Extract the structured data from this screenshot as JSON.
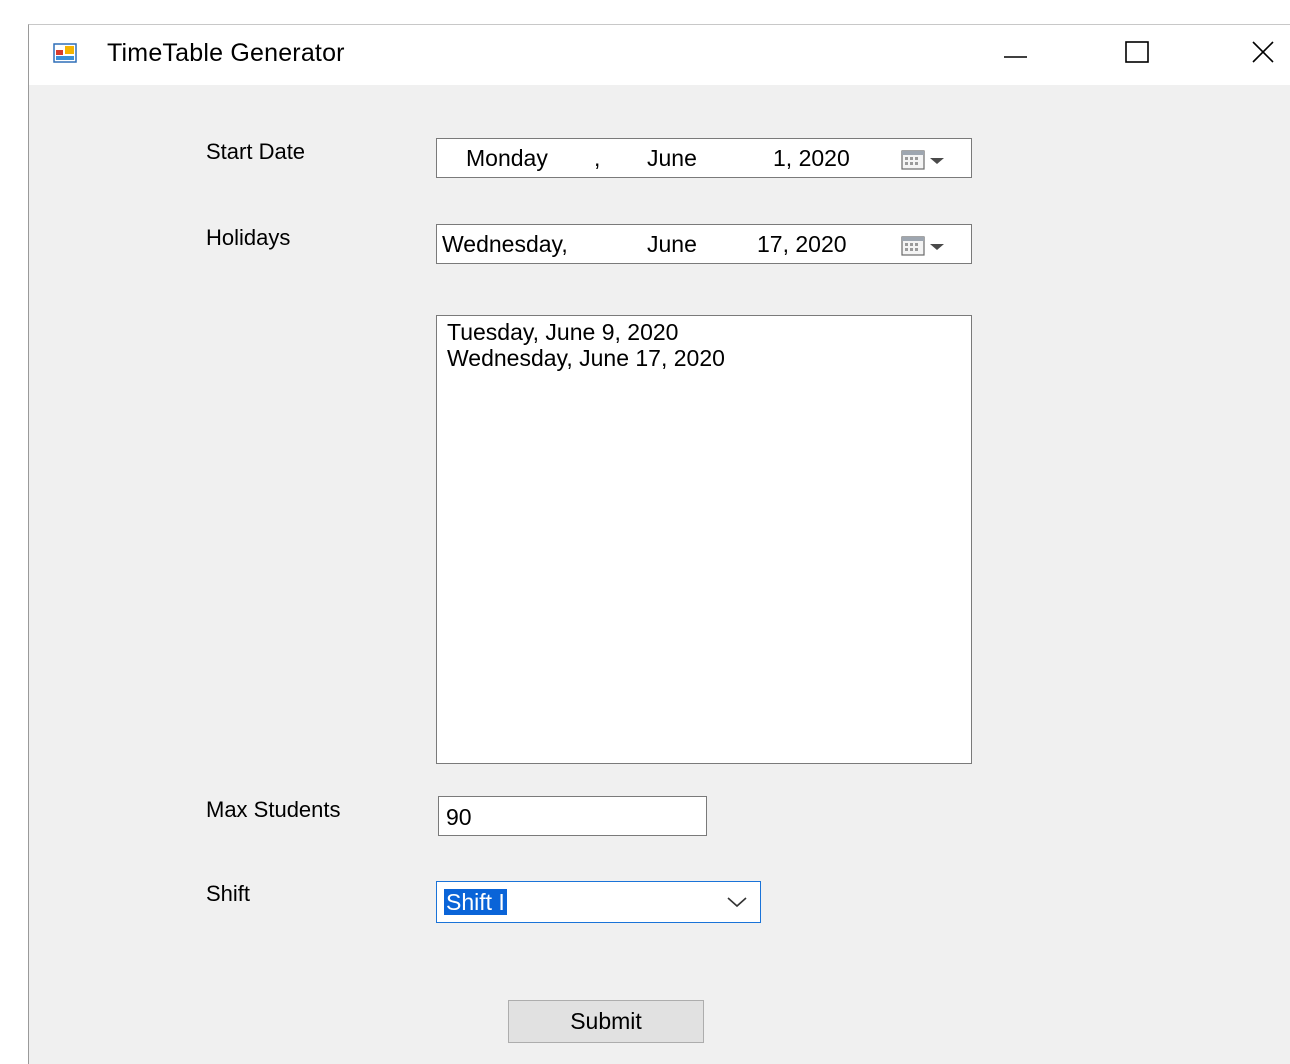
{
  "window": {
    "title": "TimeTable Generator"
  },
  "icons": {
    "app": "app-form-icon",
    "minimize": "minimize-icon",
    "maximize": "maximize-icon",
    "close": "close-icon",
    "calendar": "calendar-dropdown-icon",
    "chevron": "chevron-down-icon"
  },
  "form": {
    "start_date": {
      "label": "Start Date",
      "weekday": "Monday",
      "sep": ",",
      "month": "June",
      "day_year": "1, 2020"
    },
    "holidays": {
      "label": "Holidays",
      "weekday": "Wednesday,",
      "month": "June",
      "day_year": "17, 2020"
    },
    "holiday_list": [
      "Tuesday, June 9, 2020",
      "Wednesday, June 17, 2020"
    ],
    "max_students": {
      "label": "Max Students",
      "value": "90"
    },
    "shift": {
      "label": "Shift",
      "value": "Shift I"
    },
    "submit_label": "Submit"
  },
  "colors": {
    "window_bg": "#f0f0f0",
    "selection": "#0a64d8",
    "focus_border": "#1a73d8"
  }
}
